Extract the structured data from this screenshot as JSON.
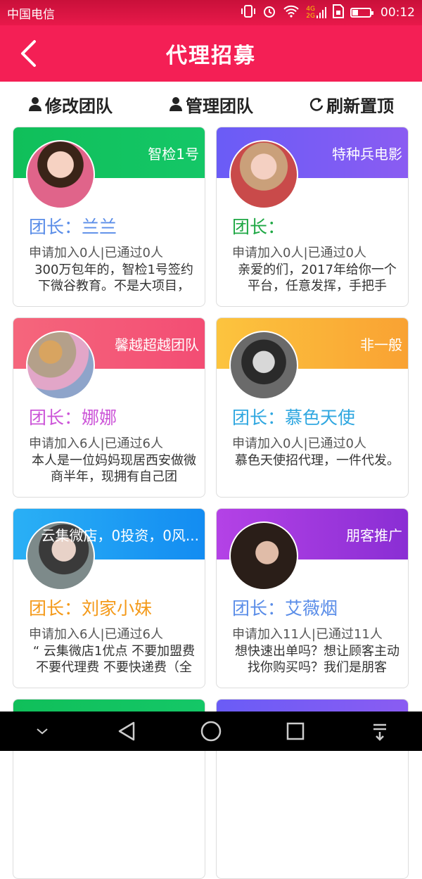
{
  "status_bar": {
    "carrier": "中国电信",
    "network_4g": "4G",
    "network_2g": "2G",
    "time": "00:12"
  },
  "header": {
    "title": "代理招募"
  },
  "actions": {
    "modify_team": "修改团队",
    "manage_team": "管理团队",
    "refresh_top": "刷新置顶"
  },
  "cards": [
    {
      "team": "智检1号",
      "leader": "团长：兰兰",
      "stats": "申请加入0人|已通过0人",
      "desc": "300万包年的，智检1号签约下微谷教育。不是大项目，",
      "banner_color": "#10bf5a",
      "leader_color": "#5a8de8"
    },
    {
      "team": "特种兵电影",
      "leader": "团长：",
      "stats": "申请加入0人|已通过0人",
      "desc": "亲爱的们，2017年给你一个平台，任意发挥，手把手",
      "banner_color": "#7a5cf5",
      "leader_color": "#1fa845"
    },
    {
      "team": "馨越超越团队",
      "leader": "团长：娜娜",
      "stats": "申请加入6人|已通过6人",
      "desc": "本人是一位妈妈现居西安做微商半年，现拥有自己团",
      "banner_color": "#f55a76",
      "leader_color": "#cc55d8"
    },
    {
      "team": "非一般",
      "leader": "团长：慕色天使",
      "stats": "申请加入0人|已通过0人",
      "desc": "慕色天使招代理，一件代发。",
      "banner_color": "#fbb33a",
      "leader_color": "#2fa7e0"
    },
    {
      "team": "云集微店，0投资，0风...",
      "leader": "团长：刘家小妹",
      "stats": "申请加入6人|已通过6人",
      "desc": "“ 云集微店1优点 不要加盟费 不要代理费 不要快递费（全",
      "banner_color": "#1ea2f4",
      "leader_color": "#f49a1a"
    },
    {
      "team": "朋客推广",
      "leader": "团长：艾薇烟",
      "stats": "申请加入11人|已通过11人",
      "desc": "想快速出单吗？想让顾客主动找你购买吗？我们是朋客",
      "banner_color": "#a43de0",
      "leader_color": "#5a8de8"
    },
    {
      "team": "",
      "leader": "",
      "stats": "",
      "desc": "",
      "banner_color": "#10bf5a",
      "leader_color": "#5a8de8"
    },
    {
      "team": "",
      "leader": "",
      "stats": "",
      "desc": "",
      "banner_color": "#7a5cf5",
      "leader_color": "#1fa845"
    }
  ]
}
